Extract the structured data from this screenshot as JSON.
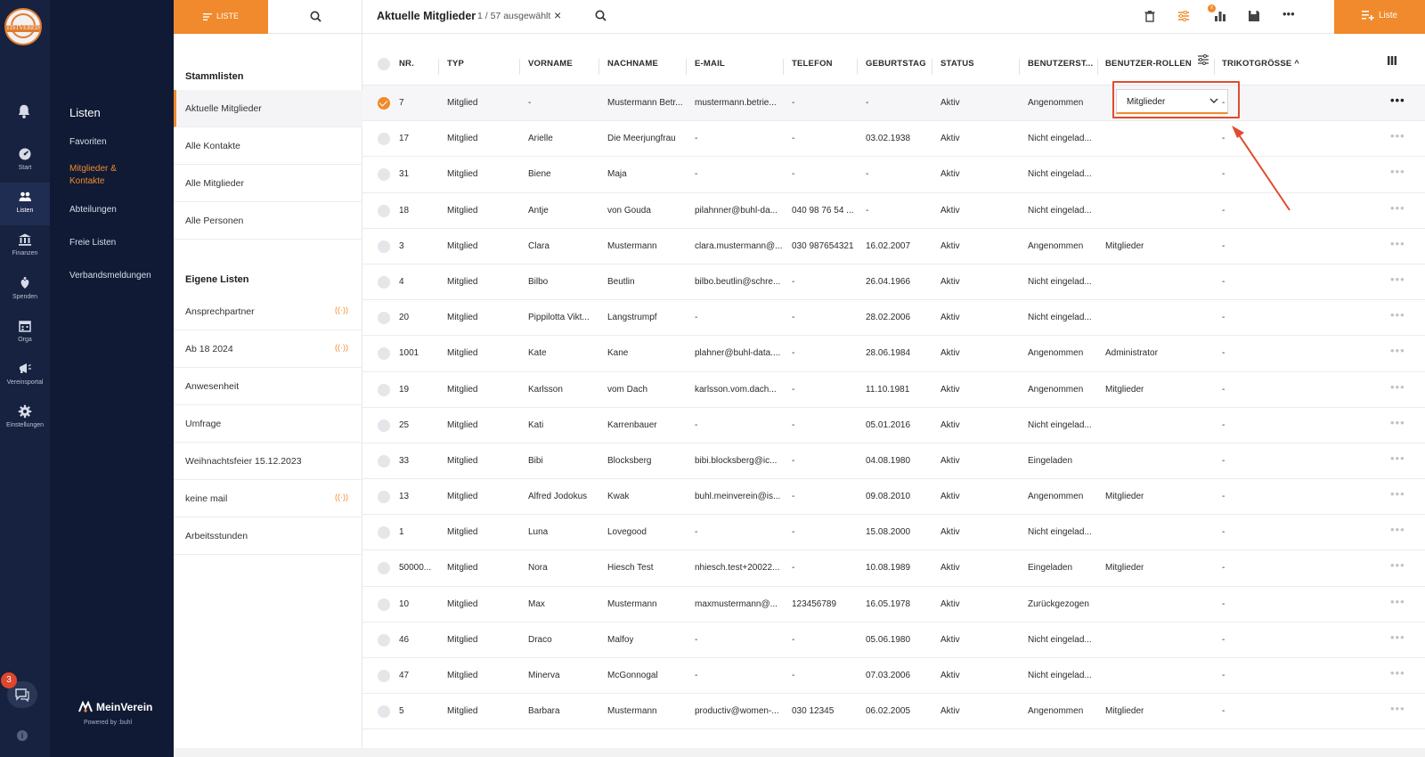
{
  "rail": {
    "logo_text": "TISTVEREIN",
    "items": [
      {
        "label": "Start",
        "icon": "dashboard-icon"
      },
      {
        "label": "Listen",
        "icon": "people-icon"
      },
      {
        "label": "Finanzen",
        "icon": "bank-icon"
      },
      {
        "label": "Spenden",
        "icon": "donation-icon"
      },
      {
        "label": "Orga",
        "icon": "calendar-icon"
      },
      {
        "label": "Vereinsportal",
        "icon": "megaphone-icon"
      },
      {
        "label": "Einstellungen",
        "icon": "gear-icon"
      }
    ],
    "chat_badge": "3"
  },
  "nav2": {
    "title": "Listen",
    "items": [
      "Favoriten",
      "Mitglieder & Kontakte",
      "Abteilungen",
      "Freie Listen",
      "Verbandsmeldungen"
    ],
    "active_index": 1,
    "brand_name": "MeinVerein",
    "powered_by": "Powered by :buhl"
  },
  "listpanel": {
    "tab_liste": "LISTE",
    "stammlisten_title": "Stammlisten",
    "stammlisten": [
      "Aktuelle Mitglieder",
      "Alle Kontakte",
      "Alle Mitglieder",
      "Alle Personen"
    ],
    "eigene_title": "Eigene Listen",
    "eigene": [
      {
        "label": "Ansprechpartner",
        "broadcast": true
      },
      {
        "label": "Ab 18 2024",
        "broadcast": true
      },
      {
        "label": "Anwesenheit",
        "broadcast": false
      },
      {
        "label": "Umfrage",
        "broadcast": false
      },
      {
        "label": "Weihnachtsfeier 15.12.2023",
        "broadcast": false
      },
      {
        "label": "keine mail",
        "broadcast": true
      },
      {
        "label": "Arbeitsstunden",
        "broadcast": false
      }
    ],
    "broadcast_glyph": "((·))"
  },
  "toolbar": {
    "title": "Aktuelle Mitglieder",
    "selection": "1 / 57 ausgewählt",
    "clear": "×",
    "filter_badge": "x",
    "more": "•••",
    "new_list_label": "Liste"
  },
  "table": {
    "columns": [
      "NR.",
      "TYP",
      "VORNAME",
      "NACHNAME",
      "E-MAIL",
      "TELEFON",
      "GEBURTSTAG",
      "STATUS",
      "BENUTZERST...",
      "BENUTZER-ROLLEN",
      "TRIKOTGRÖSSE ^"
    ],
    "role_dropdown_value": "Mitglieder",
    "rows": [
      {
        "nr": "7",
        "typ": "Mitglied",
        "vorname": "-",
        "nachname": "Mustermann Betr...",
        "email": "mustermann.betrie...",
        "telefon": "-",
        "geburtstag": "-",
        "status": "Aktiv",
        "benutzerstatus": "Angenommen",
        "rollen": "",
        "trikot": "-",
        "selected": true
      },
      {
        "nr": "17",
        "typ": "Mitglied",
        "vorname": "Arielle",
        "nachname": "Die Meerjungfrau",
        "email": "-",
        "telefon": "-",
        "geburtstag": "03.02.1938",
        "status": "Aktiv",
        "benutzerstatus": "Nicht eingelad...",
        "rollen": "",
        "trikot": "-"
      },
      {
        "nr": "31",
        "typ": "Mitglied",
        "vorname": "Biene",
        "nachname": "Maja",
        "email": "-",
        "telefon": "-",
        "geburtstag": "-",
        "status": "Aktiv",
        "benutzerstatus": "Nicht eingelad...",
        "rollen": "",
        "trikot": "-"
      },
      {
        "nr": "18",
        "typ": "Mitglied",
        "vorname": "Antje",
        "nachname": "von Gouda",
        "email": "pilahnner@buhl-da...",
        "telefon": "040 98 76 54 ...",
        "geburtstag": "-",
        "status": "Aktiv",
        "benutzerstatus": "Nicht eingelad...",
        "rollen": "",
        "trikot": "-"
      },
      {
        "nr": "3",
        "typ": "Mitglied",
        "vorname": "Clara",
        "nachname": "Mustermann",
        "email": "clara.mustermann@...",
        "telefon": "030 987654321",
        "geburtstag": "16.02.2007",
        "status": "Aktiv",
        "benutzerstatus": "Angenommen",
        "rollen": "Mitglieder",
        "trikot": "-"
      },
      {
        "nr": "4",
        "typ": "Mitglied",
        "vorname": "Bilbo",
        "nachname": "Beutlin",
        "email": "bilbo.beutlin@schre...",
        "telefon": "-",
        "geburtstag": "26.04.1966",
        "status": "Aktiv",
        "benutzerstatus": "Nicht eingelad...",
        "rollen": "",
        "trikot": "-"
      },
      {
        "nr": "20",
        "typ": "Mitglied",
        "vorname": "Pippilotta Vikt...",
        "nachname": "Langstrumpf",
        "email": "-",
        "telefon": "-",
        "geburtstag": "28.02.2006",
        "status": "Aktiv",
        "benutzerstatus": "Nicht eingelad...",
        "rollen": "",
        "trikot": "-"
      },
      {
        "nr": "1001",
        "typ": "Mitglied",
        "vorname": "Kate",
        "nachname": "Kane",
        "email": "plahner@buhl-data....",
        "telefon": "-",
        "geburtstag": "28.06.1984",
        "status": "Aktiv",
        "benutzerstatus": "Angenommen",
        "rollen": "Administrator",
        "trikot": "-"
      },
      {
        "nr": "19",
        "typ": "Mitglied",
        "vorname": "Karlsson",
        "nachname": "vom Dach",
        "email": "karlsson.vom.dach...",
        "telefon": "-",
        "geburtstag": "11.10.1981",
        "status": "Aktiv",
        "benutzerstatus": "Angenommen",
        "rollen": "Mitglieder",
        "trikot": "-"
      },
      {
        "nr": "25",
        "typ": "Mitglied",
        "vorname": "Kati",
        "nachname": "Karrenbauer",
        "email": "-",
        "telefon": "-",
        "geburtstag": "05.01.2016",
        "status": "Aktiv",
        "benutzerstatus": "Nicht eingelad...",
        "rollen": "",
        "trikot": "-"
      },
      {
        "nr": "33",
        "typ": "Mitglied",
        "vorname": "Bibi",
        "nachname": "Blocksberg",
        "email": "bibi.blocksberg@ic...",
        "telefon": "-",
        "geburtstag": "04.08.1980",
        "status": "Aktiv",
        "benutzerstatus": "Eingeladen",
        "rollen": "",
        "trikot": "-"
      },
      {
        "nr": "13",
        "typ": "Mitglied",
        "vorname": "Alfred Jodokus",
        "nachname": "Kwak",
        "email": "buhl.meinverein@is...",
        "telefon": "-",
        "geburtstag": "09.08.2010",
        "status": "Aktiv",
        "benutzerstatus": "Angenommen",
        "rollen": "Mitglieder",
        "trikot": "-"
      },
      {
        "nr": "1",
        "typ": "Mitglied",
        "vorname": "Luna",
        "nachname": "Lovegood",
        "email": "-",
        "telefon": "-",
        "geburtstag": "15.08.2000",
        "status": "Aktiv",
        "benutzerstatus": "Nicht eingelad...",
        "rollen": "",
        "trikot": "-"
      },
      {
        "nr": "50000...",
        "typ": "Mitglied",
        "vorname": "Nora",
        "nachname": "Hiesch Test",
        "email": "nhiesch.test+20022...",
        "telefon": "-",
        "geburtstag": "10.08.1989",
        "status": "Aktiv",
        "benutzerstatus": "Eingeladen",
        "rollen": "Mitglieder",
        "trikot": "-"
      },
      {
        "nr": "10",
        "typ": "Mitglied",
        "vorname": "Max",
        "nachname": "Mustermann",
        "email": "maxmustermann@...",
        "telefon": "123456789",
        "geburtstag": "16.05.1978",
        "status": "Aktiv",
        "benutzerstatus": "Zurückgezogen",
        "rollen": "",
        "trikot": "-"
      },
      {
        "nr": "46",
        "typ": "Mitglied",
        "vorname": "Draco",
        "nachname": "Malfoy",
        "email": "-",
        "telefon": "-",
        "geburtstag": "05.06.1980",
        "status": "Aktiv",
        "benutzerstatus": "Nicht eingelad...",
        "rollen": "",
        "trikot": "-"
      },
      {
        "nr": "47",
        "typ": "Mitglied",
        "vorname": "Minerva",
        "nachname": "McGonnogal",
        "email": "-",
        "telefon": "-",
        "geburtstag": "07.03.2006",
        "status": "Aktiv",
        "benutzerstatus": "Nicht eingelad...",
        "rollen": "",
        "trikot": "-"
      },
      {
        "nr": "5",
        "typ": "Mitglied",
        "vorname": "Barbara",
        "nachname": "Mustermann",
        "email": "productiv@women-...",
        "telefon": "030 12345",
        "geburtstag": "06.02.2005",
        "status": "Aktiv",
        "benutzerstatus": "Angenommen",
        "rollen": "Mitglieder",
        "trikot": "-"
      }
    ],
    "row_more": "•••"
  },
  "colors": {
    "accent": "#f08a2c",
    "rail": "#16223f",
    "nav": "#101a34",
    "highlight": "#e04c2f"
  }
}
